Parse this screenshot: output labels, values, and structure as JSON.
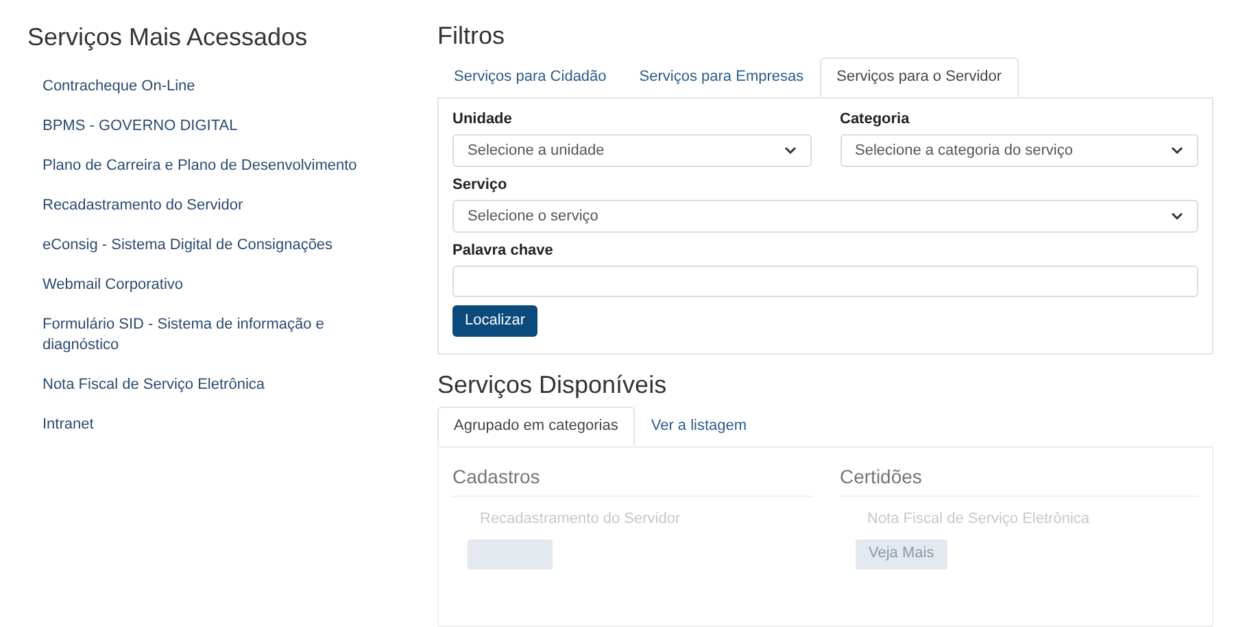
{
  "sidebar": {
    "title": "Serviços Mais Acessados",
    "items": [
      "Contracheque On-Line",
      "BPMS - GOVERNO DIGITAL",
      "Plano de Carreira e Plano de Desenvolvimento",
      "Recadastramento do Servidor",
      "eConsig - Sistema Digital de Consignações",
      "Webmail Corporativo",
      "Formulário SID - Sistema de informação e diagnóstico",
      "Nota Fiscal de Serviço Eletrônica",
      "Intranet"
    ]
  },
  "filters": {
    "title": "Filtros",
    "tabs": [
      {
        "label": "Serviços para Cidadão",
        "selected": false
      },
      {
        "label": "Serviços para Empresas",
        "selected": false
      },
      {
        "label": "Serviços para o Servidor",
        "selected": true
      }
    ],
    "unit": {
      "label": "Unidade",
      "placeholder": "Selecione a unidade"
    },
    "category": {
      "label": "Categoria",
      "placeholder": "Selecione a categoria do serviço"
    },
    "service": {
      "label": "Serviço",
      "placeholder": "Selecione o serviço"
    },
    "keyword": {
      "label": "Palavra chave"
    },
    "button": "Localizar"
  },
  "available": {
    "title": "Serviços Disponíveis",
    "tabs": [
      {
        "label": "Agrupado em categorias",
        "selected": true
      },
      {
        "label": "Ver a listagem",
        "selected": false
      }
    ],
    "groups": [
      {
        "title": "Cadastros",
        "item": "Recadastramento do Servidor"
      },
      {
        "title": "Certidões",
        "item": "Nota Fiscal de Serviço Eletrônica",
        "button": "Veja Mais"
      }
    ]
  }
}
